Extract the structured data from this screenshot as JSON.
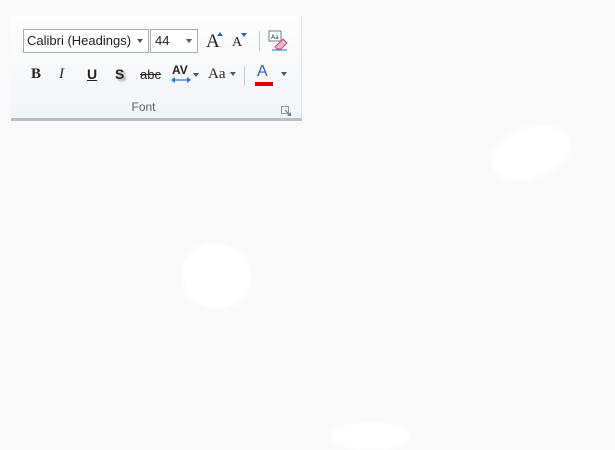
{
  "font_group": {
    "font_name": "Calibri (Headings)",
    "font_size": "44",
    "label": "Font",
    "buttons": {
      "bold": "B",
      "italic": "I",
      "underline": "U",
      "shadow": "S",
      "strikethrough": "abc",
      "char_spacing": "AV",
      "change_case": "Aa",
      "font_color": "A",
      "grow": "A",
      "shrink": "A"
    },
    "colors": {
      "font_color_bar": "#e00000",
      "clear_format_accent": "#2e6fd6"
    }
  }
}
